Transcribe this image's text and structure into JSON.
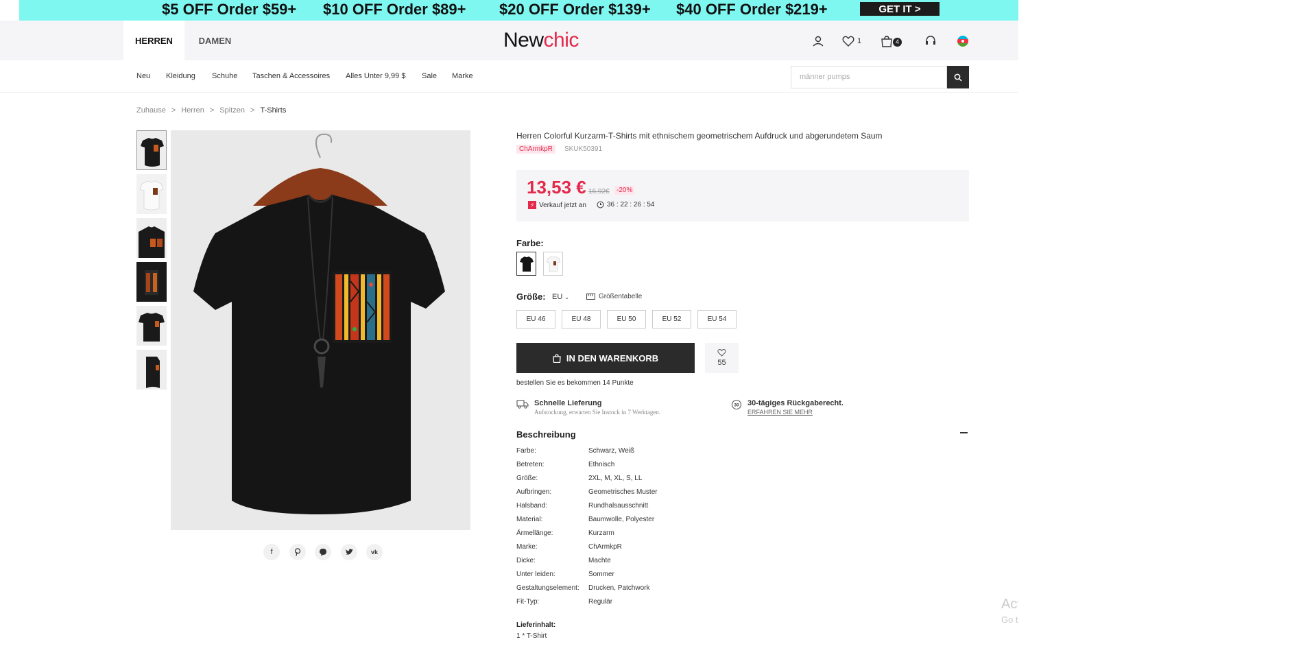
{
  "promo": {
    "offers": [
      "$5 OFF Order $59+",
      "$10 OFF Order $89+",
      "$20 OFF Order $139+",
      "$40 OFF Order $219+"
    ],
    "cta": "GET IT >"
  },
  "header": {
    "tabs": [
      {
        "label": "HERREN",
        "active": true
      },
      {
        "label": "DAMEN",
        "active": false
      }
    ],
    "logo_new": "New",
    "logo_chic": "chic",
    "wishlist_count": "1",
    "cart_count": "4"
  },
  "nav": {
    "items": [
      "Neu",
      "Kleidung",
      "Schuhe",
      "Taschen & Accessoires",
      "Alles Unter 9,99 $",
      "Sale",
      "Marke"
    ],
    "search_placeholder": "männer pumps"
  },
  "breadcrumb": {
    "items": [
      "Zuhause",
      "Herren",
      "Spitzen"
    ],
    "separator": ">",
    "current": "T-Shirts"
  },
  "product": {
    "title": "Herren Colorful Kurzarm-T-Shirts mit ethnischem geometrischem Aufdruck und abgerundetem Saum",
    "brand_tag": "ChArmkpR",
    "sku": "SKUK50391",
    "price": "13,53 €",
    "old_price": "16,92€",
    "discount": "-20%",
    "flash_label": "Verkauf jetzt an",
    "countdown": "36 : 22 : 26 : 54",
    "color_label": "Farbe:",
    "size_label": "Größe:",
    "size_unit": "EU",
    "size_table": "Größentabelle",
    "sizes": [
      "EU 46",
      "EU 48",
      "EU 50",
      "EU 52",
      "EU 54"
    ],
    "cart_label": "IN DEN WARENKORB",
    "wish_count": "55",
    "points": "bestellen Sie es bekommen 14 Punkte"
  },
  "service": {
    "delivery_title": "Schnelle Lieferung",
    "delivery_sub": "Aufstockung, erwarten Sie Instock in 7 Werktagen.",
    "return_title": "30-tägiges Rückgaberecht.",
    "return_link": "ERFAHREN SIE MEHR",
    "return_badge": "30"
  },
  "description": {
    "title": "Beschreibung",
    "specs": [
      {
        "k": "Farbe:",
        "v": "Schwarz, Weiß"
      },
      {
        "k": "Betreten:",
        "v": "Ethnisch"
      },
      {
        "k": "Größe:",
        "v": "2XL, M, XL, S, LL"
      },
      {
        "k": "Aufbringen:",
        "v": "Geometrisches Muster"
      },
      {
        "k": "Halsband:",
        "v": "Rundhalsausschnitt"
      },
      {
        "k": "Material:",
        "v": "Baumwolle, Polyester"
      },
      {
        "k": "Ärmellänge:",
        "v": "Kurzarm"
      },
      {
        "k": "Marke:",
        "v": "ChArmkpR"
      },
      {
        "k": "Dicke:",
        "v": "Machte"
      },
      {
        "k": "Unter leiden:",
        "v": "Sommer"
      },
      {
        "k": "Gestaltungselement:",
        "v": "Drucken, Patchwork"
      },
      {
        "k": "Fit-Typ:",
        "v": "Regulär"
      }
    ],
    "content_label": "Lieferinhalt:",
    "content_value": "1 * T-Shirt"
  },
  "watermark": {
    "line1": "Act",
    "line2": "Go t"
  },
  "colors": {
    "accent": "#e4294b",
    "promo_bg": "#7ff7f1",
    "dark": "#2b2b2b"
  }
}
